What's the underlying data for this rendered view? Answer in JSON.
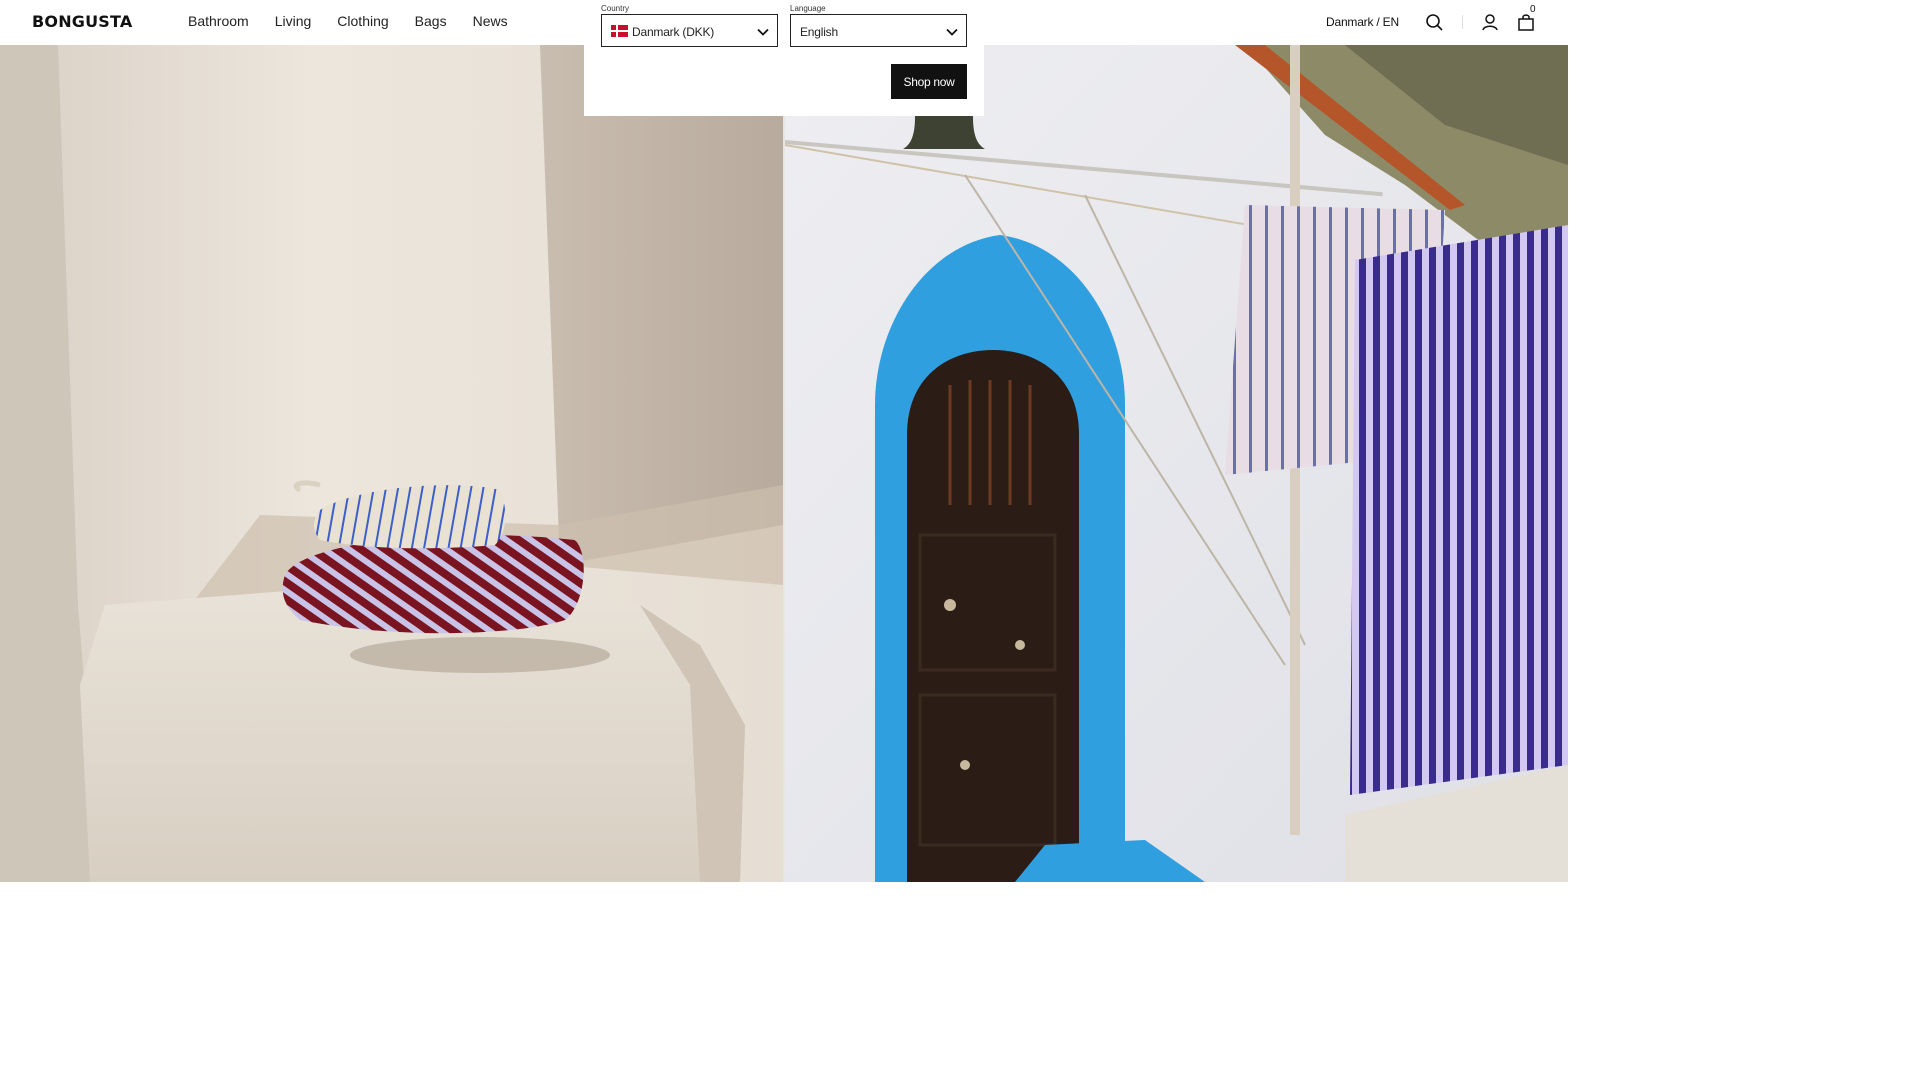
{
  "header": {
    "logo": "BONGUSTA",
    "nav": [
      "Bathroom",
      "Living",
      "Clothing",
      "Bags",
      "News"
    ],
    "locale": "Danmark / EN",
    "cart_count": "0",
    "icons": [
      "search-icon",
      "account-icon",
      "bag-icon"
    ]
  },
  "popup": {
    "country_label": "Country",
    "country_value": "Danmark (DKK)",
    "language_label": "Language",
    "language_value": "English",
    "button": "Shop now"
  },
  "colors": {
    "accent": "#111111",
    "door_frame_blue": "#2f9fe0"
  }
}
